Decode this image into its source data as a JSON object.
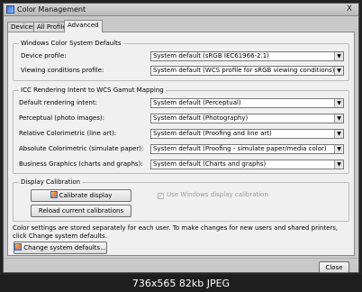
{
  "window": {
    "title": "Color Management",
    "close_glyph": "X"
  },
  "tabs": [
    {
      "label": "Devices"
    },
    {
      "label": "All Profiles"
    },
    {
      "label": "Advanced"
    }
  ],
  "defaults_group": {
    "title": "Windows Color System Defaults",
    "rows": [
      {
        "label": "Device profile:",
        "value": "System default (sRGB IEC61966-2.1)"
      },
      {
        "label": "Viewing conditions profile:",
        "value": "System default (WCS profile for sRGB viewing conditions)"
      }
    ]
  },
  "icc_group": {
    "title": "ICC Rendering Intent to WCS Gamut Mapping",
    "rows": [
      {
        "label": "Default rendering intent:",
        "value": "System default (Perceptual)"
      },
      {
        "label": "Perceptual (photo images):",
        "value": "System default (Photography)"
      },
      {
        "label": "Relative Colorimetric (line art):",
        "value": "System default (Proofing and line art)"
      },
      {
        "label": "Absolute Colorimetric (simulate paper):",
        "value": "System default (Proofing - simulate paper/media color)"
      },
      {
        "label": "Business Graphics (charts and graphs):",
        "value": "System default (Charts and graphs)"
      }
    ]
  },
  "calibration_group": {
    "title": "Display Calibration",
    "calibrate_label": "Calibrate display",
    "reload_label": "Reload current calibrations",
    "checkbox_label": "Use Windows display calibration",
    "checkbox_checked": true
  },
  "note": "Color settings are stored separately for each user. To make changes for new users and shared printers, click Change system defaults.",
  "change_defaults_label": "Change system defaults...",
  "close_label": "Close",
  "footer": {
    "caption": "736x565 82kb JPEG"
  }
}
